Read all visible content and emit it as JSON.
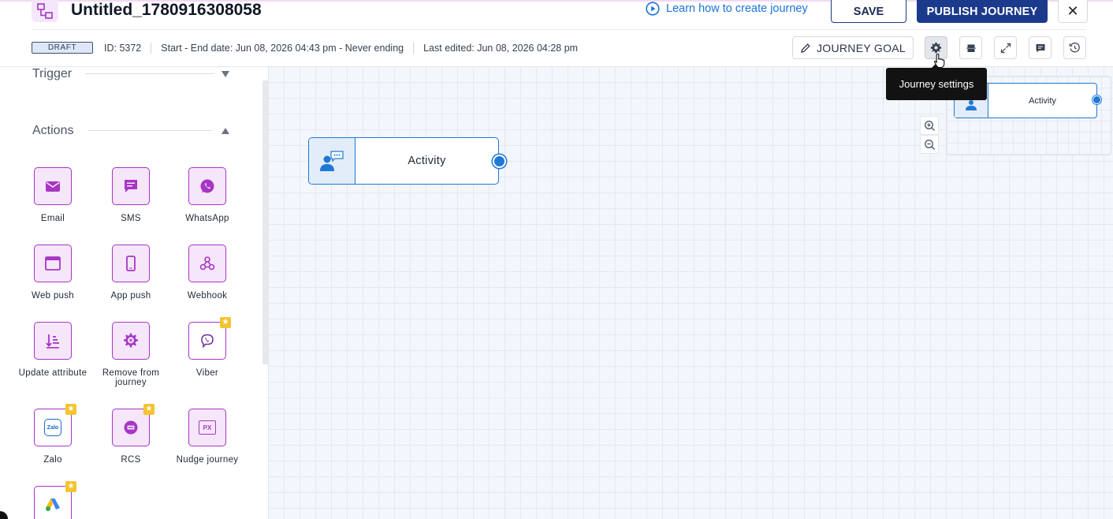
{
  "header": {
    "title": "Untitled_1780916308058",
    "learn_link": "Learn how to create journey",
    "save_label": "SAVE",
    "publish_label": "PUBLISH JOURNEY",
    "close_label": "✕"
  },
  "meta": {
    "status_badge": "DRAFT",
    "id": "ID: 5372",
    "schedule": "Start - End date: Jun 08, 2026 04:43 pm - Never ending",
    "last_edited": "Last edited: Jun 08, 2026 04:28 pm"
  },
  "toolbar": {
    "goal_label": "JOURNEY GOAL",
    "buttons": [
      "gear-icon",
      "align-icon",
      "expand-icon",
      "comment-icon",
      "history-icon"
    ],
    "tooltip": "Journey settings"
  },
  "sidebar": {
    "trigger_label": "Trigger",
    "actions_label": "Actions",
    "actions": [
      {
        "label": "Email",
        "icon": "email-icon"
      },
      {
        "label": "SMS",
        "icon": "sms-icon"
      },
      {
        "label": "WhatsApp",
        "icon": "whatsapp-icon"
      },
      {
        "label": "Web push",
        "icon": "web-push-icon"
      },
      {
        "label": "App push",
        "icon": "app-push-icon"
      },
      {
        "label": "Webhook",
        "icon": "webhook-icon"
      },
      {
        "label": "Update attribute",
        "icon": "update-attribute-icon"
      },
      {
        "label": "Remove from journey",
        "icon": "remove-journey-icon"
      },
      {
        "label": "Viber",
        "icon": "viber-icon",
        "premium": true
      },
      {
        "label": "Zalo",
        "icon": "zalo-icon",
        "premium": true
      },
      {
        "label": "RCS",
        "icon": "rcs-icon",
        "premium": true
      },
      {
        "label": "Nudge journey",
        "icon": "nudge-icon"
      },
      {
        "label": "",
        "icon": "google-ads-icon",
        "premium": true
      }
    ],
    "zalo_text": "Zalo",
    "nudge_text": "PX"
  },
  "canvas": {
    "node_label": "Activity",
    "minimap_node_label": "Activity"
  },
  "colors": {
    "accent_blue": "#1e78d6",
    "publish_bg": "#1c3a8c",
    "action_purple": "#a636c4",
    "premium_star": "#f4c430"
  }
}
